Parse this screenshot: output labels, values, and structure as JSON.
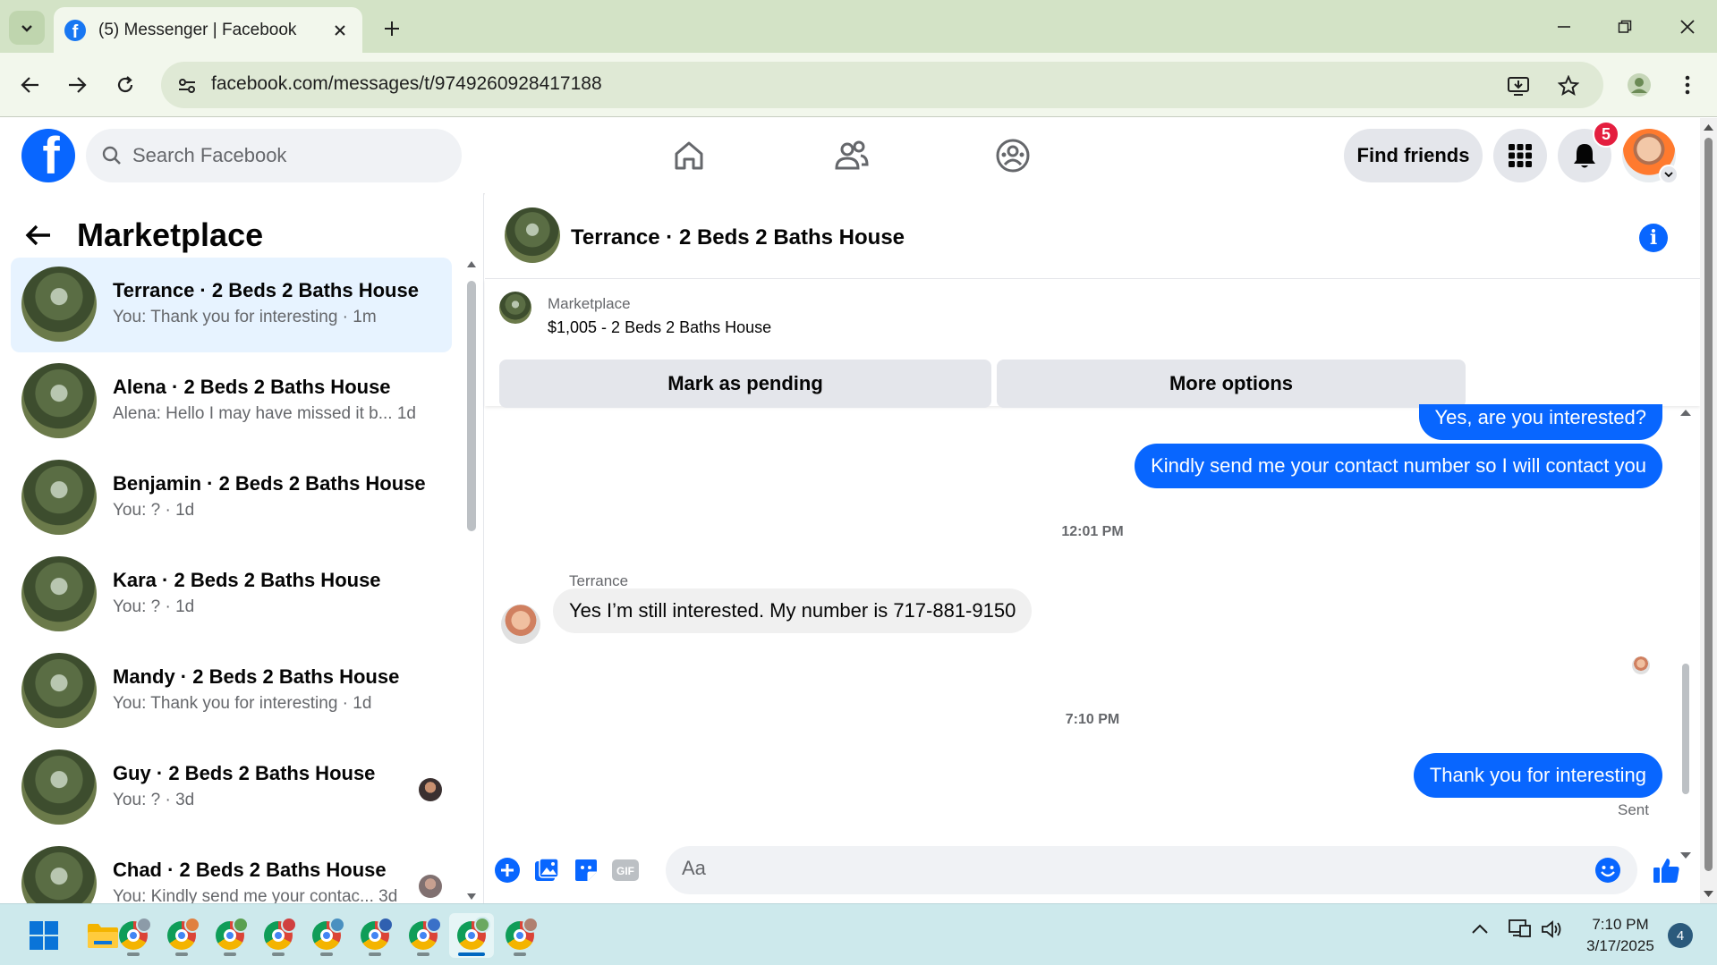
{
  "browser": {
    "tab_title": "(5) Messenger | Facebook",
    "url": "facebook.com/messages/t/9749260928417188"
  },
  "facebook": {
    "search_placeholder": "Search Facebook",
    "find_friends_label": "Find friends",
    "notification_count": "5"
  },
  "left_panel": {
    "title": "Marketplace",
    "conversations": [
      {
        "name": "Terrance · 2 Beds 2 Baths House",
        "preview": "You: Thank you for interesting · 1m",
        "active": true
      },
      {
        "name": "Alena · 2 Beds 2 Baths House",
        "preview": "Alena: Hello I may have missed it b...   1d"
      },
      {
        "name": "Benjamin · 2 Beds 2 Baths House",
        "preview": "You: ? · 1d"
      },
      {
        "name": "Kara · 2 Beds 2 Baths House",
        "preview": "You: ? · 1d"
      },
      {
        "name": "Mandy · 2 Beds 2 Baths House",
        "preview": "You: Thank you for interesting · 1d"
      },
      {
        "name": "Guy · 2 Beds 2 Baths House",
        "preview": "You: ? · 3d"
      },
      {
        "name": "Chad · 2 Beds 2 Baths House",
        "preview": "You: Kindly send me your contac...   3d"
      }
    ]
  },
  "chat": {
    "title": "Terrance · 2 Beds 2 Baths House",
    "marketplace_label": "Marketplace",
    "listing": "$1,005 - 2 Beds 2 Baths House",
    "mark_pending_label": "Mark as pending",
    "more_options_label": "More options",
    "messages": {
      "out_1": "Yes, are you interested?",
      "out_2": "Kindly send me your contact number so I will contact you",
      "time_1": "12:01 PM",
      "sender": "Terrance",
      "in_1": "Yes I’m still interested. My number is 717-881-9150",
      "time_2": "7:10 PM",
      "out_3": "Thank you for interesting",
      "status": "Sent"
    },
    "composer_placeholder": "Aa"
  },
  "taskbar": {
    "time": "7:10 PM",
    "date": "3/17/2025",
    "notification_count": "4"
  },
  "colors": {
    "facebook_blue": "#0866ff",
    "active_conversation": "#e7f3ff",
    "notification_red": "#e41e3f",
    "tabstrip": "#d3e3c6"
  }
}
